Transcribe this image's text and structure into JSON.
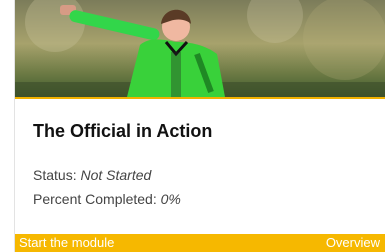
{
  "card": {
    "title": "The Official in Action",
    "status_label": "Status:",
    "status_value": "Not Started",
    "percent_label": "Percent Completed:",
    "percent_value": "0%",
    "start_label": "Start the module",
    "overview_label": "Overview"
  },
  "colors": {
    "accent": "#f6b800",
    "referee_shirt": "#39d13a"
  }
}
